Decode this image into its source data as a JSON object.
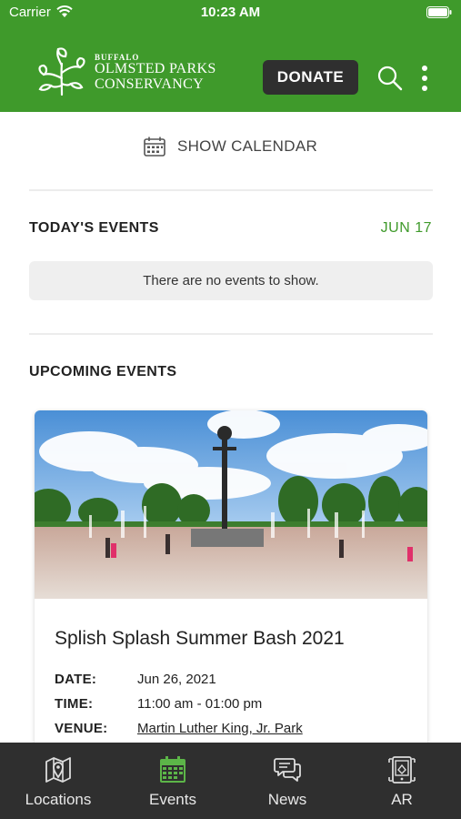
{
  "status_bar": {
    "carrier": "Carrier",
    "time": "10:23 AM"
  },
  "header": {
    "logo": {
      "line1": "BUFFALO",
      "line2": "OLMSTED PARKS",
      "line3": "CONSERVANCY"
    },
    "donate_label": "DONATE",
    "brand_color": "#3f9a2b",
    "icons": [
      "search-icon",
      "more-vertical-icon"
    ]
  },
  "calendar_toggle": {
    "label": "SHOW CALENDAR",
    "icon": "calendar-icon"
  },
  "todays_events": {
    "title": "TODAY'S EVENTS",
    "date": "JUN 17",
    "empty_message": "There are no events to show."
  },
  "upcoming_events": {
    "title": "UPCOMING EVENTS",
    "events": [
      {
        "title": "Splish Splash Summer Bash 2021",
        "date_label": "DATE:",
        "date": "Jun 26, 2021",
        "time_label": "TIME:",
        "time": "11:00 am - 01:00 pm",
        "venue_label": "VENUE:",
        "venue": "Martin Luther King, Jr. Park"
      }
    ]
  },
  "tabs": [
    {
      "label": "Locations",
      "icon": "map-pin-icon",
      "active": false
    },
    {
      "label": "Events",
      "icon": "calendar-icon",
      "active": true
    },
    {
      "label": "News",
      "icon": "chat-bubbles-icon",
      "active": false
    },
    {
      "label": "AR",
      "icon": "ar-icon",
      "active": false
    }
  ]
}
